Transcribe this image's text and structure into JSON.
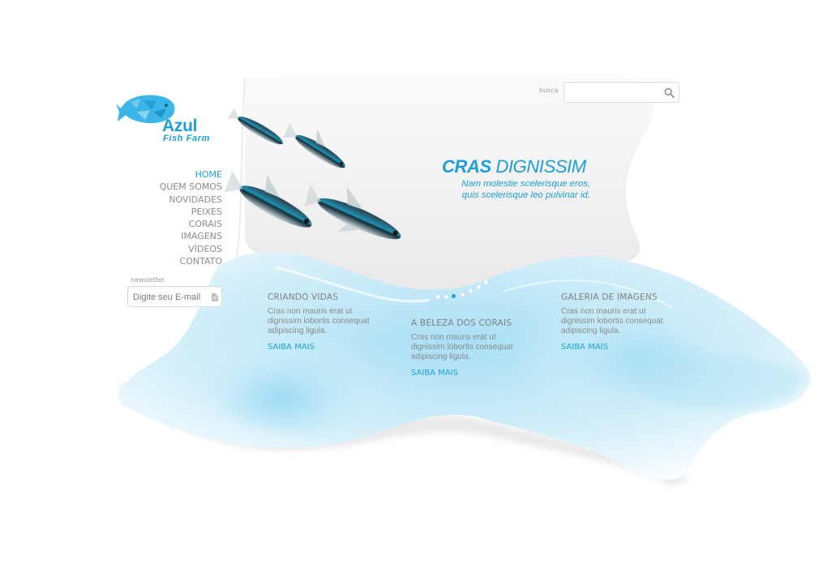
{
  "brand": {
    "name": "Azul",
    "subtitle": "Fish Farm",
    "logo_icon": "fish-logo-icon"
  },
  "nav": {
    "items": [
      {
        "label": "HOME",
        "active": true
      },
      {
        "label": "QUEM SOMOS",
        "active": false
      },
      {
        "label": "NOVIDADES",
        "active": false
      },
      {
        "label": "PEIXES",
        "active": false
      },
      {
        "label": "CORAIS",
        "active": false
      },
      {
        "label": "IMAGENS",
        "active": false
      },
      {
        "label": "VÍDEOS",
        "active": false
      },
      {
        "label": "CONTATO",
        "active": false
      }
    ]
  },
  "newsletter": {
    "label": "newsletter",
    "placeholder": "Digite seu E-mail",
    "icon": "send-icon"
  },
  "search": {
    "label": "busca",
    "placeholder": "",
    "icon": "search-icon"
  },
  "hero": {
    "title_part1": "CRAS",
    "title_part2": "DIGNISSIM",
    "subtitle_line1": "Nam molestie scelerisque eros,",
    "subtitle_line2": "quis scelerisque leo pulvinar id.",
    "slide_count": 7,
    "active_slide": 2
  },
  "features": [
    {
      "title": "CRIANDO VIDAS",
      "body": [
        "Cras non mauris erat ut",
        "dignissim lobortis consequat",
        "adipiscing ligula."
      ],
      "link": "SAIBA MAIS"
    },
    {
      "title": "A BELEZA DOS CORAIS",
      "body": [
        "Cras non mauris erat ut",
        "dignissim lobortis consequat",
        "adipiscing ligula."
      ],
      "link": "SAIBA MAIS"
    },
    {
      "title": "GALERIA DE IMAGENS",
      "body": [
        "Cras non mauris erat ut",
        "dignissim lobortis consequat",
        "adipiscing ligula."
      ],
      "link": "SAIBA MAIS"
    }
  ],
  "colors": {
    "accent": "#1aa3d8",
    "text": "#7f7f7f",
    "water": "#bfe6f6"
  }
}
